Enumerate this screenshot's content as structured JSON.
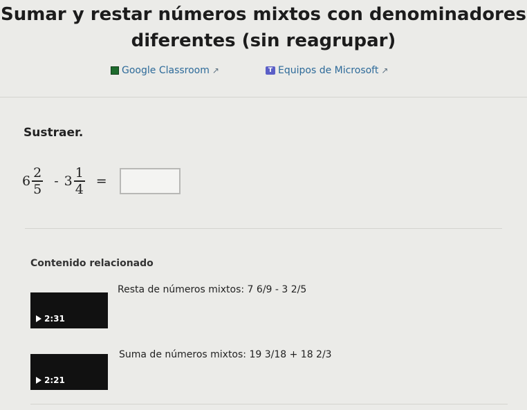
{
  "title": "Sumar y restar números mixtos con denominadores diferentes (sin reagrupar)",
  "share": {
    "google_classroom": "Google Classroom",
    "microsoft_teams": "Equipos de Microsoft"
  },
  "exercise": {
    "prompt": "Sustraer.",
    "term1": {
      "whole": "6",
      "num": "2",
      "den": "5"
    },
    "operator": "-",
    "term2": {
      "whole": "3",
      "num": "1",
      "den": "4"
    },
    "equals": "=",
    "answer_value": ""
  },
  "related": {
    "heading": "Contenido relacionado",
    "videos": [
      {
        "title": "Resta de números mixtos: 7 6/9 - 3 2/5",
        "duration": "2:31"
      },
      {
        "title": "Suma de números mixtos: 19 3/18 + 18 2/3",
        "duration": "2:21"
      }
    ]
  },
  "colors": {
    "link": "#2d6a99",
    "background": "#ebebe8",
    "video_bg": "#111111"
  }
}
